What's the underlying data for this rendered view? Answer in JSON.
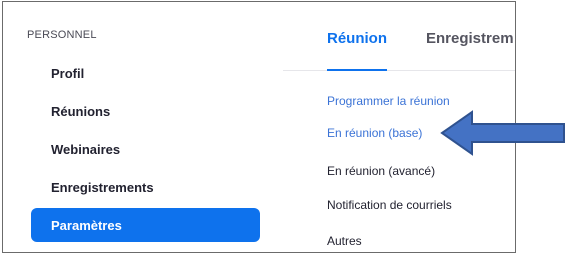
{
  "sidebar": {
    "section_label": "PERSONNEL",
    "items": [
      {
        "label": "Profil",
        "active": false
      },
      {
        "label": "Réunions",
        "active": false
      },
      {
        "label": "Webinaires",
        "active": false
      },
      {
        "label": "Enregistrements",
        "active": false
      },
      {
        "label": "Paramètres",
        "active": true
      }
    ]
  },
  "content": {
    "tabs": [
      {
        "label": "Réunion",
        "active": true
      },
      {
        "label": "Enregistrem",
        "active": false
      }
    ],
    "links": [
      {
        "label": "Programmer la réunion"
      },
      {
        "label": "En réunion (base)"
      },
      {
        "label": "En réunion (avancé)"
      },
      {
        "label": "Notification de courriels"
      },
      {
        "label": "Autres"
      }
    ]
  },
  "annotation": {
    "arrow_icon": "left-arrow-icon",
    "arrow_color": "#4472c4",
    "arrow_outline": "#2f528f"
  },
  "colors": {
    "accent": "#0e72ed",
    "link_blue": "#3b73d6"
  }
}
